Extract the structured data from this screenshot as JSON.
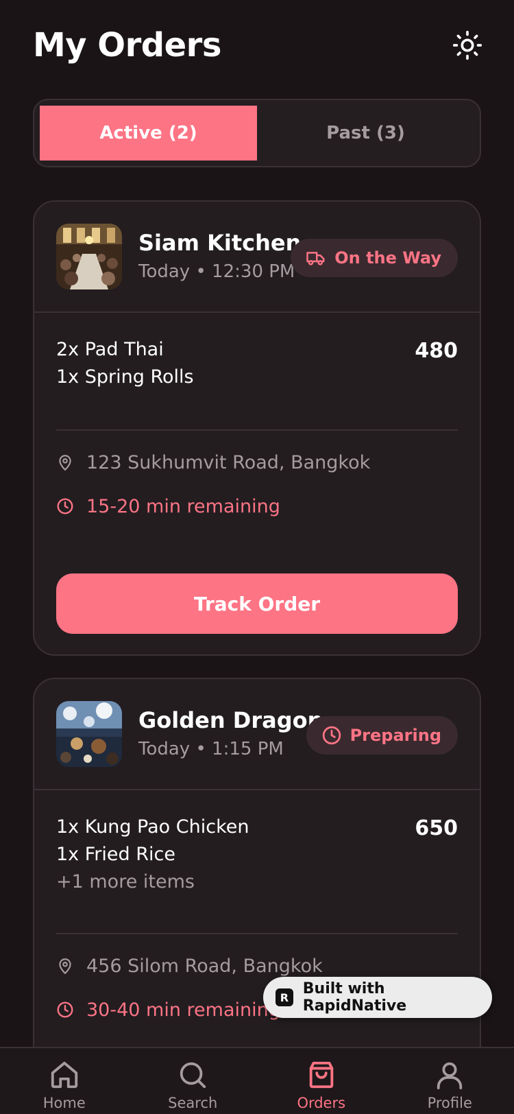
{
  "header": {
    "title": "My Orders",
    "theme_icon": "sun-icon"
  },
  "tabs": [
    {
      "label": "Active (2)",
      "active": true
    },
    {
      "label": "Past (3)",
      "active": false
    }
  ],
  "orders": [
    {
      "restaurant": "Siam Kitchen",
      "time": "Today • 12:30 PM",
      "status": "On the Way",
      "status_icon": "truck-icon",
      "items": [
        "2x Pad Thai",
        "1x Spring Rolls"
      ],
      "more": "",
      "price": "480",
      "address": "123 Sukhumvit Road, Bangkok",
      "eta": "15-20 min remaining",
      "action": "Track Order"
    },
    {
      "restaurant": "Golden Dragon",
      "time": "Today • 1:15 PM",
      "status": "Preparing",
      "status_icon": "clock-icon",
      "items": [
        "1x Kung Pao Chicken",
        "1x Fried Rice"
      ],
      "more": "+1 more items",
      "price": "650",
      "address": "456 Silom Road, Bangkok",
      "eta": "30-40 min remaining"
    }
  ],
  "built_with": "Built with RapidNative",
  "nav": [
    {
      "label": "Home",
      "icon": "home-icon"
    },
    {
      "label": "Search",
      "icon": "search-icon"
    },
    {
      "label": "Orders",
      "icon": "shopping-bag-icon",
      "active": true
    },
    {
      "label": "Profile",
      "icon": "user-icon"
    }
  ],
  "colors": {
    "accent": "#fd7485",
    "background": "#1a1416",
    "card": "#231d20",
    "border": "#3a3035",
    "muted": "#a59ca0"
  }
}
